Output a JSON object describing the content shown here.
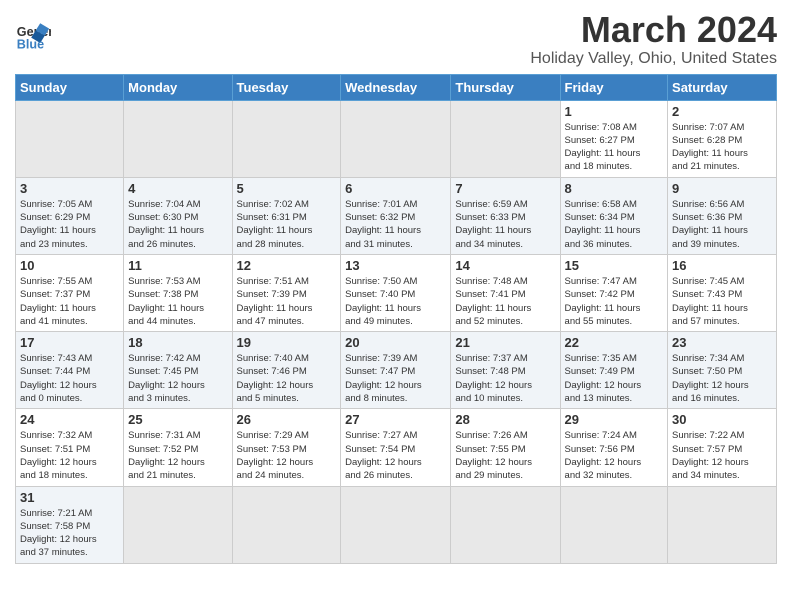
{
  "header": {
    "logo_general": "General",
    "logo_blue": "Blue",
    "month_title": "March 2024",
    "subtitle": "Holiday Valley, Ohio, United States"
  },
  "weekdays": [
    "Sunday",
    "Monday",
    "Tuesday",
    "Wednesday",
    "Thursday",
    "Friday",
    "Saturday"
  ],
  "weeks": [
    [
      {
        "day": "",
        "info": "",
        "empty": true
      },
      {
        "day": "",
        "info": "",
        "empty": true
      },
      {
        "day": "",
        "info": "",
        "empty": true
      },
      {
        "day": "",
        "info": "",
        "empty": true
      },
      {
        "day": "",
        "info": "",
        "empty": true
      },
      {
        "day": "1",
        "info": "Sunrise: 7:08 AM\nSunset: 6:27 PM\nDaylight: 11 hours\nand 18 minutes."
      },
      {
        "day": "2",
        "info": "Sunrise: 7:07 AM\nSunset: 6:28 PM\nDaylight: 11 hours\nand 21 minutes."
      }
    ],
    [
      {
        "day": "3",
        "info": "Sunrise: 7:05 AM\nSunset: 6:29 PM\nDaylight: 11 hours\nand 23 minutes."
      },
      {
        "day": "4",
        "info": "Sunrise: 7:04 AM\nSunset: 6:30 PM\nDaylight: 11 hours\nand 26 minutes."
      },
      {
        "day": "5",
        "info": "Sunrise: 7:02 AM\nSunset: 6:31 PM\nDaylight: 11 hours\nand 28 minutes."
      },
      {
        "day": "6",
        "info": "Sunrise: 7:01 AM\nSunset: 6:32 PM\nDaylight: 11 hours\nand 31 minutes."
      },
      {
        "day": "7",
        "info": "Sunrise: 6:59 AM\nSunset: 6:33 PM\nDaylight: 11 hours\nand 34 minutes."
      },
      {
        "day": "8",
        "info": "Sunrise: 6:58 AM\nSunset: 6:34 PM\nDaylight: 11 hours\nand 36 minutes."
      },
      {
        "day": "9",
        "info": "Sunrise: 6:56 AM\nSunset: 6:36 PM\nDaylight: 11 hours\nand 39 minutes."
      }
    ],
    [
      {
        "day": "10",
        "info": "Sunrise: 7:55 AM\nSunset: 7:37 PM\nDaylight: 11 hours\nand 41 minutes."
      },
      {
        "day": "11",
        "info": "Sunrise: 7:53 AM\nSunset: 7:38 PM\nDaylight: 11 hours\nand 44 minutes."
      },
      {
        "day": "12",
        "info": "Sunrise: 7:51 AM\nSunset: 7:39 PM\nDaylight: 11 hours\nand 47 minutes."
      },
      {
        "day": "13",
        "info": "Sunrise: 7:50 AM\nSunset: 7:40 PM\nDaylight: 11 hours\nand 49 minutes."
      },
      {
        "day": "14",
        "info": "Sunrise: 7:48 AM\nSunset: 7:41 PM\nDaylight: 11 hours\nand 52 minutes."
      },
      {
        "day": "15",
        "info": "Sunrise: 7:47 AM\nSunset: 7:42 PM\nDaylight: 11 hours\nand 55 minutes."
      },
      {
        "day": "16",
        "info": "Sunrise: 7:45 AM\nSunset: 7:43 PM\nDaylight: 11 hours\nand 57 minutes."
      }
    ],
    [
      {
        "day": "17",
        "info": "Sunrise: 7:43 AM\nSunset: 7:44 PM\nDaylight: 12 hours\nand 0 minutes."
      },
      {
        "day": "18",
        "info": "Sunrise: 7:42 AM\nSunset: 7:45 PM\nDaylight: 12 hours\nand 3 minutes."
      },
      {
        "day": "19",
        "info": "Sunrise: 7:40 AM\nSunset: 7:46 PM\nDaylight: 12 hours\nand 5 minutes."
      },
      {
        "day": "20",
        "info": "Sunrise: 7:39 AM\nSunset: 7:47 PM\nDaylight: 12 hours\nand 8 minutes."
      },
      {
        "day": "21",
        "info": "Sunrise: 7:37 AM\nSunset: 7:48 PM\nDaylight: 12 hours\nand 10 minutes."
      },
      {
        "day": "22",
        "info": "Sunrise: 7:35 AM\nSunset: 7:49 PM\nDaylight: 12 hours\nand 13 minutes."
      },
      {
        "day": "23",
        "info": "Sunrise: 7:34 AM\nSunset: 7:50 PM\nDaylight: 12 hours\nand 16 minutes."
      }
    ],
    [
      {
        "day": "24",
        "info": "Sunrise: 7:32 AM\nSunset: 7:51 PM\nDaylight: 12 hours\nand 18 minutes."
      },
      {
        "day": "25",
        "info": "Sunrise: 7:31 AM\nSunset: 7:52 PM\nDaylight: 12 hours\nand 21 minutes."
      },
      {
        "day": "26",
        "info": "Sunrise: 7:29 AM\nSunset: 7:53 PM\nDaylight: 12 hours\nand 24 minutes."
      },
      {
        "day": "27",
        "info": "Sunrise: 7:27 AM\nSunset: 7:54 PM\nDaylight: 12 hours\nand 26 minutes."
      },
      {
        "day": "28",
        "info": "Sunrise: 7:26 AM\nSunset: 7:55 PM\nDaylight: 12 hours\nand 29 minutes."
      },
      {
        "day": "29",
        "info": "Sunrise: 7:24 AM\nSunset: 7:56 PM\nDaylight: 12 hours\nand 32 minutes."
      },
      {
        "day": "30",
        "info": "Sunrise: 7:22 AM\nSunset: 7:57 PM\nDaylight: 12 hours\nand 34 minutes."
      }
    ],
    [
      {
        "day": "31",
        "info": "Sunrise: 7:21 AM\nSunset: 7:58 PM\nDaylight: 12 hours\nand 37 minutes."
      },
      {
        "day": "",
        "info": "",
        "empty": true
      },
      {
        "day": "",
        "info": "",
        "empty": true
      },
      {
        "day": "",
        "info": "",
        "empty": true
      },
      {
        "day": "",
        "info": "",
        "empty": true
      },
      {
        "day": "",
        "info": "",
        "empty": true
      },
      {
        "day": "",
        "info": "",
        "empty": true
      }
    ]
  ]
}
